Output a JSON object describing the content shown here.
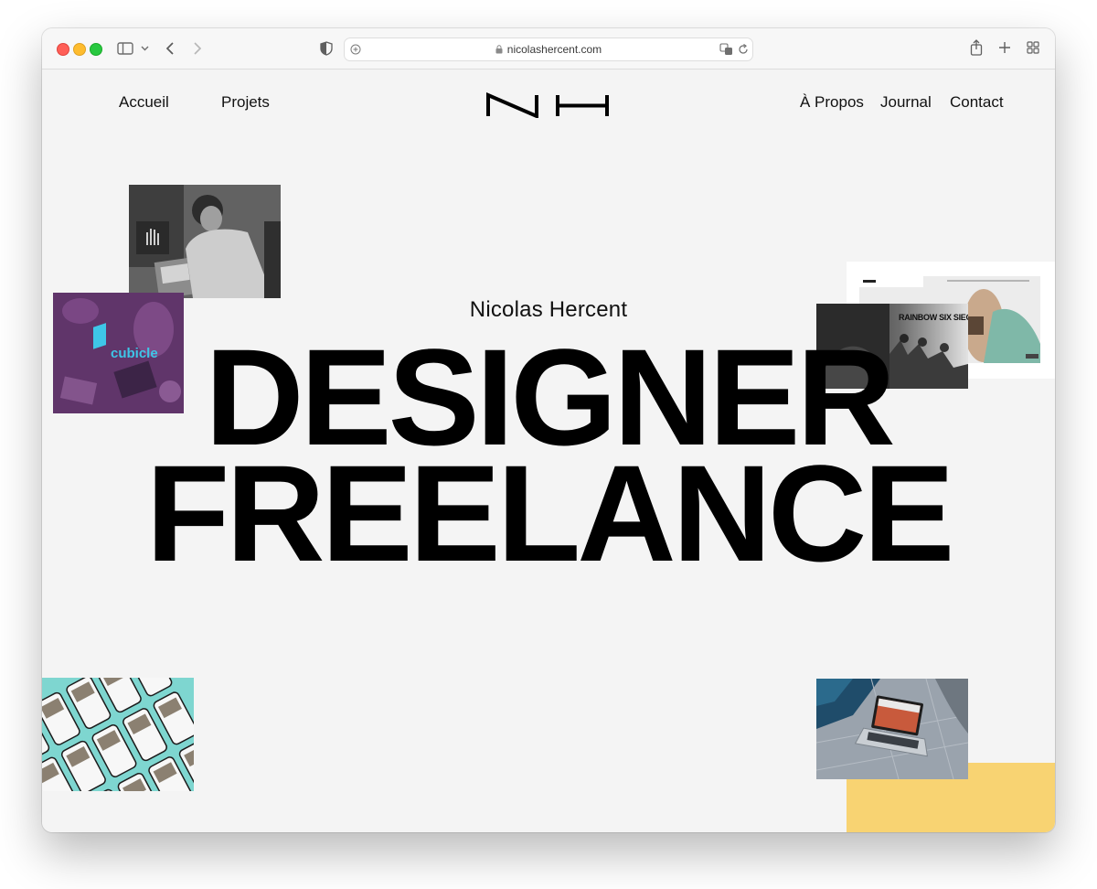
{
  "browser": {
    "url": "nicolashercent.com"
  },
  "nav": {
    "home": "Accueil",
    "projects": "Projets",
    "logo": "NH",
    "about": "À Propos",
    "journal": "Journal",
    "contact": "Contact"
  },
  "hero": {
    "name": "Nicolas Hercent",
    "line1": "DESIGNER",
    "line2": "FREELANCE"
  },
  "thumbnails": {
    "cubicle_label": "cubicle",
    "game_label": "RAINBOW SIX SIEGE"
  },
  "colors": {
    "background": "#f4f4f4",
    "accent_yellow": "#f8d372",
    "cubicle_purple": "#6a3a72",
    "cubicle_logo": "#3ec6e8",
    "phones_teal": "#7ed6d0"
  }
}
